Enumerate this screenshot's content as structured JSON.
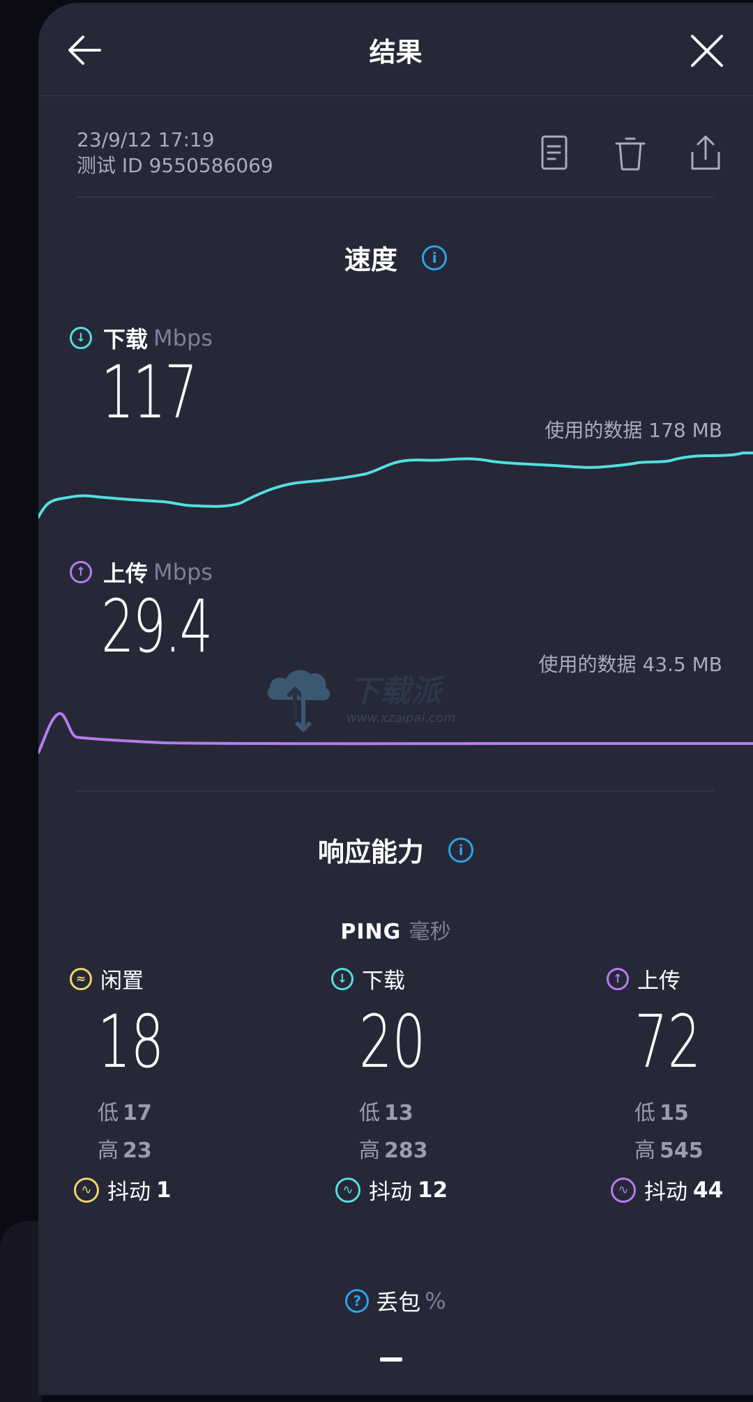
{
  "header": {
    "title": "结果"
  },
  "meta": {
    "datetime": "23/9/12 17:19",
    "test_id": "测试 ID 9550586069"
  },
  "speed": {
    "title": "速度",
    "download": {
      "label": "下载",
      "unit": "Mbps",
      "value": "117",
      "data_used": "使用的数据 178 MB"
    },
    "upload": {
      "label": "上传",
      "unit": "Mbps",
      "value": "29.4",
      "data_used": "使用的数据 43.5 MB"
    }
  },
  "responsiveness": {
    "title": "响应能力",
    "ping_label": "PING",
    "ping_unit": "毫秒",
    "columns": [
      {
        "label": "闲置",
        "value": "18",
        "low_label": "低",
        "low": "17",
        "high_label": "高",
        "high": "23",
        "jitter_label": "抖动",
        "jitter": "1",
        "color": "#f0d56a"
      },
      {
        "label": "下载",
        "value": "20",
        "low_label": "低",
        "low": "13",
        "high_label": "高",
        "high": "283",
        "jitter_label": "抖动",
        "jitter": "12",
        "color": "#54dfe0"
      },
      {
        "label": "上传",
        "value": "72",
        "low_label": "低",
        "low": "15",
        "high_label": "高",
        "high": "545",
        "jitter_label": "抖动",
        "jitter": "44",
        "color": "#b77cf0"
      }
    ]
  },
  "packet_loss": {
    "label": "丢包",
    "unit": "%",
    "value": "—"
  },
  "watermark": {
    "brand": "下载派",
    "url": "www.xzaipai.com"
  },
  "colors": {
    "download": "#54dfe0",
    "upload": "#b77cf0",
    "idle": "#f0d56a",
    "info": "#2aa5e8",
    "background": "#262838"
  },
  "icons": {
    "back": "arrow-left-icon",
    "close": "close-icon",
    "notes": "document-icon",
    "delete": "trash-icon",
    "share": "share-icon"
  }
}
